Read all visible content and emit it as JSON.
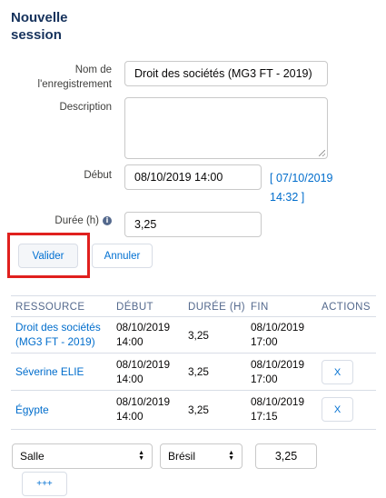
{
  "form": {
    "title": "Nouvelle session",
    "nom_label": "Nom de l'enregistrement",
    "nom_value": "Droit des sociétés (MG3 FT - 2019)",
    "description_label": "Description",
    "description_value": "",
    "debut_label": "Début",
    "debut_value": "08/10/2019 14:00",
    "debut_link": "[ 07/10/2019 14:32 ]",
    "duree_label": "Durée (h)",
    "duree_value": "3,25",
    "info_icon": "info-icon"
  },
  "buttons": {
    "valider": "Valider",
    "annuler": "Annuler",
    "add": "+++"
  },
  "table": {
    "headers": [
      "RESSOURCE",
      "DÉBUT",
      "DURÉE (H)",
      "FIN",
      "ACTIONS"
    ],
    "rows": [
      {
        "ressource": "Droit des sociétés (MG3 FT - 2019)",
        "debut": "08/10/2019 14:00",
        "duree": "3,25",
        "fin": "08/10/2019 17:00",
        "action": ""
      },
      {
        "ressource": "Séverine ELIE",
        "debut": "08/10/2019 14:00",
        "duree": "3,25",
        "fin": "08/10/2019 17:00",
        "action": "X"
      },
      {
        "ressource": "Égypte",
        "debut": "08/10/2019 14:00",
        "duree": "3,25",
        "fin": "08/10/2019 17:15",
        "action": "X"
      }
    ]
  },
  "add_row": {
    "type_select": "Salle",
    "resource_select": "Brésil",
    "duree": "3,25"
  },
  "colors": {
    "highlight": "#e0201e",
    "link": "#006dcc",
    "title": "#16325c"
  }
}
